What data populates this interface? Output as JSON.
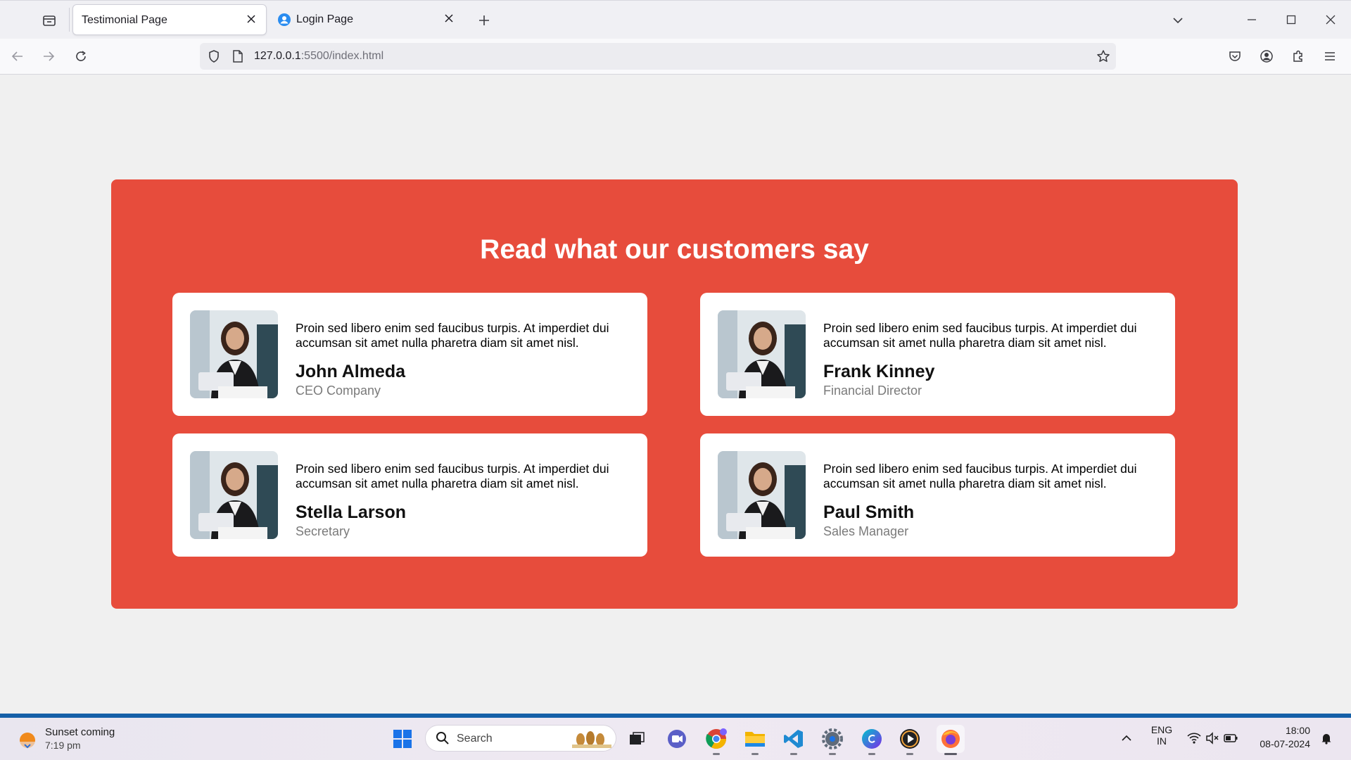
{
  "browser": {
    "tabs": [
      {
        "label": "Testimonial Page",
        "active": true
      },
      {
        "label": "Login Page",
        "active": false
      }
    ],
    "url": {
      "host": "127.0.0.1",
      "rest": ":5500/index.html"
    }
  },
  "page": {
    "heading": "Read what our customers say",
    "accent_color": "#e74c3c",
    "testimonials": [
      {
        "quote": "Proin sed libero enim sed faucibus turpis. At imperdiet dui accumsan sit amet nulla pharetra diam sit amet nisl.",
        "name": "John Almeda",
        "role": "CEO Company"
      },
      {
        "quote": "Proin sed libero enim sed faucibus turpis. At imperdiet dui accumsan sit amet nulla pharetra diam sit amet nisl.",
        "name": "Frank Kinney",
        "role": "Financial Director"
      },
      {
        "quote": "Proin sed libero enim sed faucibus turpis. At imperdiet dui accumsan sit amet nulla pharetra diam sit amet nisl.",
        "name": "Stella Larson",
        "role": "Secretary"
      },
      {
        "quote": "Proin sed libero enim sed faucibus turpis. At imperdiet dui accumsan sit amet nulla pharetra diam sit amet nisl.",
        "name": "Paul Smith",
        "role": "Sales Manager"
      }
    ]
  },
  "taskbar": {
    "weather": {
      "title": "Sunset coming",
      "subtitle": "7:19 pm"
    },
    "search_label": "Search",
    "apps": [
      "task-view",
      "meet",
      "chrome",
      "file-explorer",
      "vscode",
      "settings",
      "canva",
      "media-player",
      "firefox"
    ],
    "tray": {
      "lang_top": "ENG",
      "lang_bottom": "IN",
      "time": "18:00",
      "date": "08-07-2024"
    }
  }
}
